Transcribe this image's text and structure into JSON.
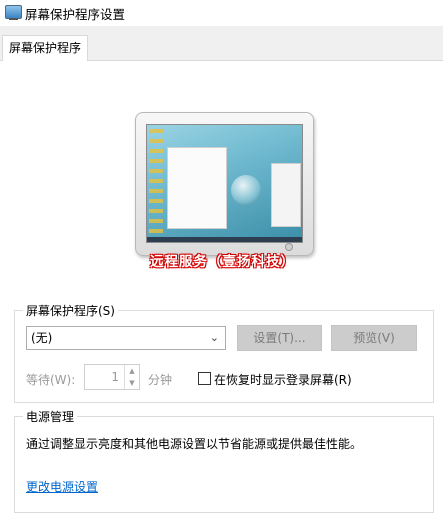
{
  "window": {
    "title": "屏幕保护程序设置",
    "tab": "屏幕保护程序"
  },
  "preview": {
    "watermark": "远程服务（壹扬科技）"
  },
  "screensaver": {
    "legend": "屏幕保护程序(S)",
    "selected": "(无)",
    "settings_label": "设置(T)...",
    "preview_label": "预览(V)",
    "wait_label": "等待(W):",
    "wait_value": "1",
    "minutes_label": "分钟",
    "resume_checked": false,
    "resume_label": "在恢复时显示登录屏幕(R)"
  },
  "power": {
    "legend": "电源管理",
    "description": "通过调整显示亮度和其他电源设置以节省能源或提供最佳性能。",
    "link": "更改电源设置"
  },
  "colors": {
    "link": "#0066cc",
    "disabled_button": "#cccccc",
    "watermark_outline": "#d00000"
  }
}
